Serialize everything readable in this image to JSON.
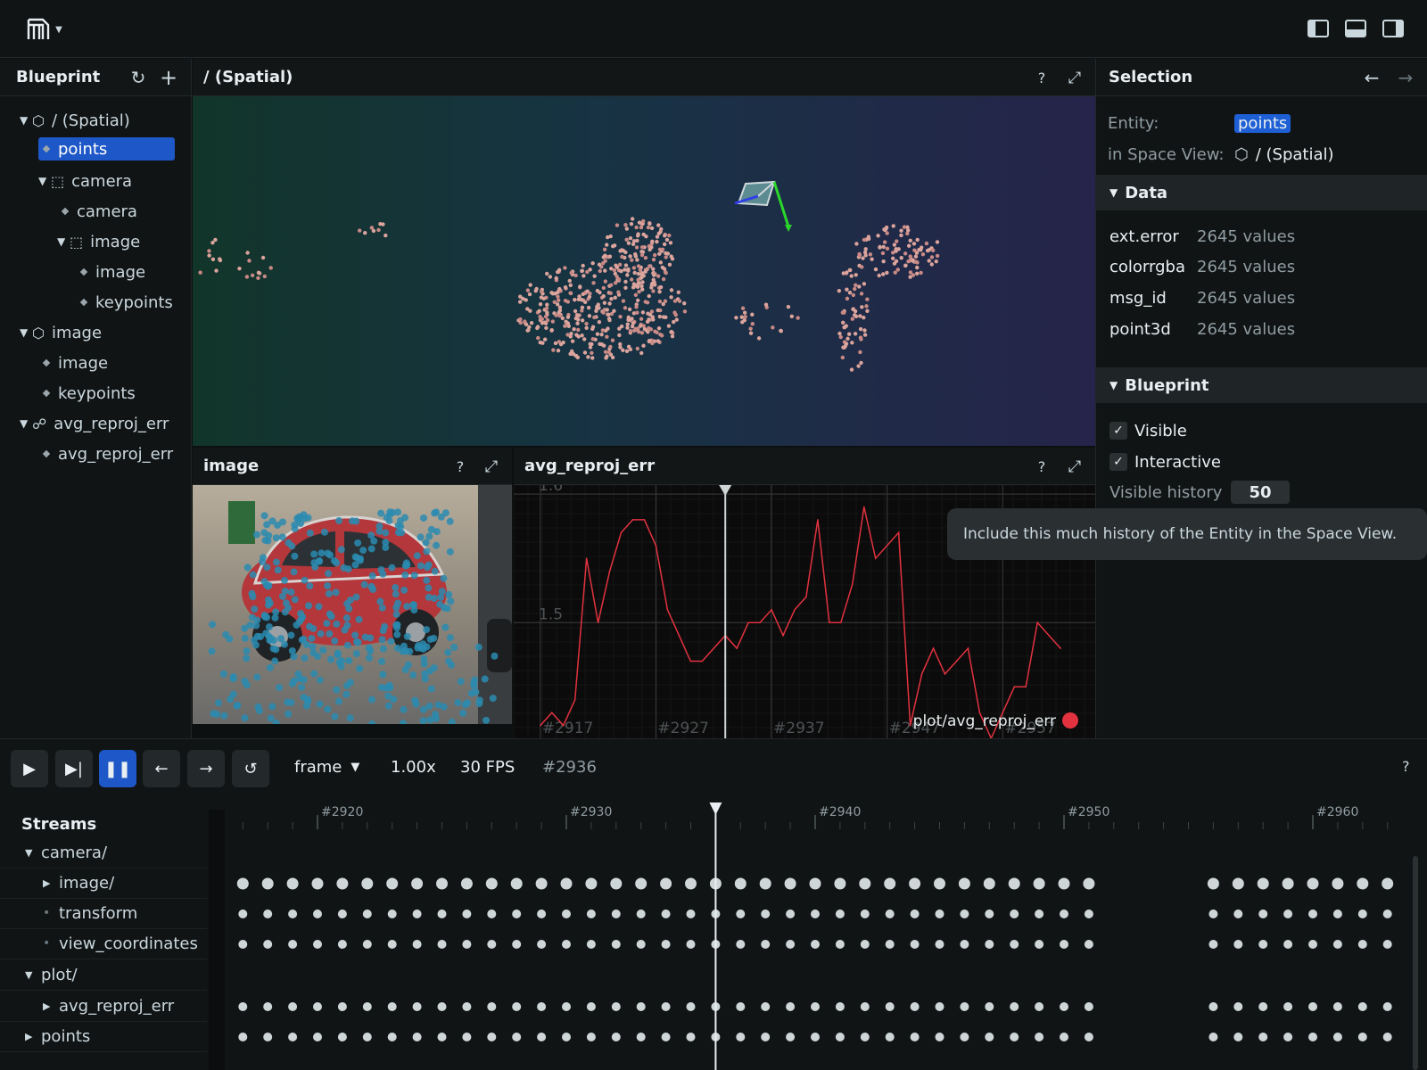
{
  "topbar": {
    "logo": "rerun-logo"
  },
  "blueprint": {
    "title": "Blueprint",
    "tree": [
      {
        "label": "/ (Spatial)",
        "indent": 0,
        "kind": "space",
        "expanded": true
      },
      {
        "label": "points",
        "indent": 1,
        "kind": "entity",
        "selected": true
      },
      {
        "label": "camera",
        "indent": 1,
        "kind": "group",
        "expanded": true
      },
      {
        "label": "camera",
        "indent": 2,
        "kind": "entity"
      },
      {
        "label": "image",
        "indent": 2,
        "kind": "group",
        "expanded": true
      },
      {
        "label": "image",
        "indent": 3,
        "kind": "entity"
      },
      {
        "label": "keypoints",
        "indent": 3,
        "kind": "entity"
      },
      {
        "label": "image",
        "indent": 0,
        "kind": "space",
        "expanded": true
      },
      {
        "label": "image",
        "indent": 1,
        "kind": "entity"
      },
      {
        "label": "keypoints",
        "indent": 1,
        "kind": "entity"
      },
      {
        "label": "avg_reproj_err",
        "indent": 0,
        "kind": "plot",
        "expanded": true
      },
      {
        "label": "avg_reproj_err",
        "indent": 1,
        "kind": "entity"
      }
    ]
  },
  "views": {
    "spatial_title": "/ (Spatial)",
    "image_title": "image",
    "plot_title": "avg_reproj_err",
    "help": "?"
  },
  "selection": {
    "title": "Selection",
    "entity_label": "Entity:",
    "entity_value": "points",
    "space_label": "in Space View:",
    "space_value": "/ (Spatial)",
    "data_header": "Data",
    "data": [
      {
        "key": "ext.error",
        "value": "2645 values"
      },
      {
        "key": "colorrgba",
        "value": "2645 values"
      },
      {
        "key": "msg_id",
        "value": "2645 values"
      },
      {
        "key": "point3d",
        "value": "2645 values"
      }
    ],
    "blueprint_header": "Blueprint",
    "visible_label": "Visible",
    "interactive_label": "Interactive",
    "history_label": "Visible history",
    "history_value": "50",
    "tooltip": "Include this much history of the Entity in the Space View."
  },
  "chart_data": {
    "type": "line",
    "title": "",
    "x_tick_labels": [
      "#2917",
      "#2927",
      "#2937",
      "#2947",
      "#2957"
    ],
    "y_tick_labels": [
      "1.6",
      "1.5"
    ],
    "ylim": [
      1.41,
      1.607
    ],
    "xlim": [
      2914.7,
      2965
    ],
    "cursor_x": 2933,
    "series": [
      {
        "name": "plot/avg_reproj_err",
        "color": "#e2323f",
        "x": [
          2917,
          2918,
          2919,
          2920,
          2921,
          2922,
          2923,
          2924,
          2925,
          2926,
          2927,
          2928,
          2929,
          2930,
          2931,
          2932,
          2933,
          2934,
          2935,
          2936,
          2937,
          2938,
          2939,
          2940,
          2941,
          2942,
          2943,
          2944,
          2945,
          2946,
          2947,
          2948,
          2949,
          2950,
          2951,
          2952,
          2953,
          2954,
          2955,
          2956,
          2957,
          2958,
          2959,
          2960,
          2961,
          2962
        ],
        "y": [
          1.42,
          1.43,
          1.42,
          1.44,
          1.55,
          1.5,
          1.54,
          1.57,
          1.58,
          1.58,
          1.56,
          1.51,
          1.49,
          1.47,
          1.47,
          1.48,
          1.49,
          1.48,
          1.5,
          1.5,
          1.51,
          1.49,
          1.51,
          1.52,
          1.58,
          1.5,
          1.5,
          1.53,
          1.59,
          1.55,
          1.56,
          1.57,
          1.42,
          1.46,
          1.48,
          1.46,
          1.47,
          1.48,
          1.43,
          1.41,
          1.43,
          1.45,
          1.45,
          1.5,
          1.49,
          1.48
        ]
      }
    ]
  },
  "timeline": {
    "timeline_name": "frame",
    "speed": "1.00x",
    "fps": "30 FPS",
    "current_frame": "#2936",
    "help": "?",
    "streams_title": "Streams",
    "tick_labels": [
      "#2920",
      "#2930",
      "#2940",
      "#2950",
      "#2960"
    ],
    "rows": [
      {
        "label": "camera/",
        "indent": 0,
        "marker": "open"
      },
      {
        "label": "image/",
        "indent": 1,
        "marker": "closed",
        "dots": "big"
      },
      {
        "label": "transform",
        "indent": 1,
        "marker": "dot",
        "dots": "small"
      },
      {
        "label": "view_coordinates",
        "indent": 1,
        "marker": "dot",
        "dots": "small"
      },
      {
        "label": "plot/",
        "indent": 0,
        "marker": "open"
      },
      {
        "label": "avg_reproj_err",
        "indent": 1,
        "marker": "closed",
        "dots": "small"
      },
      {
        "label": "points",
        "indent": 0,
        "marker": "closed",
        "dots": "small"
      }
    ]
  },
  "colors": {
    "accent": "#1e57c7",
    "selection_text": "#1e5fd6",
    "plot_line": "#e2323f",
    "bg": "#0d1011"
  }
}
